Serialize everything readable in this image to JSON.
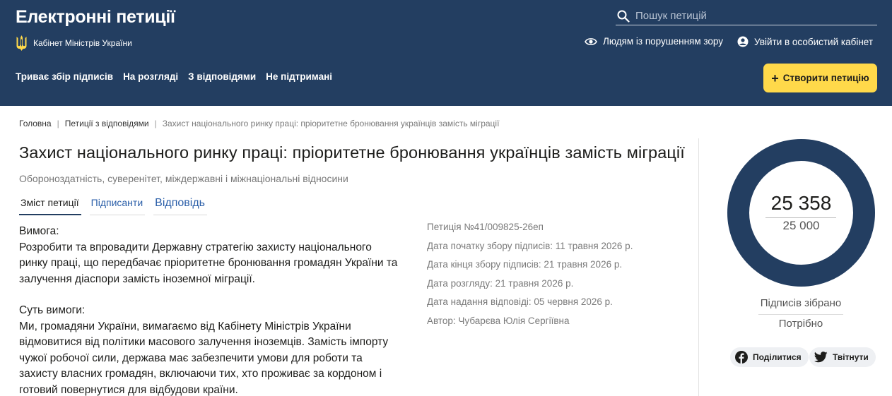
{
  "header": {
    "site_title": "Електронні петиції",
    "organization": "Кабінет Міністрів України",
    "search_placeholder": "Пошук петицій",
    "accessibility_label": "Людям із порушенням зору",
    "login_label": "Увійти в особистий кабінет",
    "nav": [
      {
        "label": "Триває збір підписів"
      },
      {
        "label": "На розгляді"
      },
      {
        "label": "З відповідями"
      },
      {
        "label": "Не підтримані"
      }
    ],
    "create_label": "Створити петицію",
    "accent_color": "#ffd94a",
    "brand_color": "#233e61"
  },
  "breadcrumb": {
    "home": "Головна",
    "section": "Петиції з відповідями",
    "current": "Захист національного ринку праці: пріоритетне бронювання українців замість міграції"
  },
  "petition": {
    "title": "Захист національного ринку праці: пріоритетне бронювання українців замість міграції",
    "category": "Обороноздатність, суверенітет, міждержавні і міжнаціональні відносини",
    "tabs": [
      {
        "label": "Зміст петиції"
      },
      {
        "label": "Підписанти"
      },
      {
        "label": "Відповідь"
      }
    ],
    "demand_heading": "Вимога:",
    "demand_text": "Розробити та впровадити Державну стратегію захисту національного ринку праці, що передбачає пріоритетне бронювання громадян України та залучення діаспори замість іноземної міграції.",
    "essence_heading": "Суть вимоги:",
    "essence_text": "Ми, громадяни України, вимагаємо від Кабінету Міністрів України відмовитися від політики масового залучення іноземців. Замість імпорту чужої робочої сили, держава має забезпечити умови для роботи та захисту власних громадян, включаючи тих, хто проживає за кордоном і готовий повернутися для відбудови країни."
  },
  "meta": {
    "number": "Петиція №41/009825-26еп",
    "start_date": "Дата початку збору підписів: 11 травня 2026 р.",
    "end_date": "Дата кінця збору підписів: 21 травня 2026 р.",
    "review_date": "Дата розгляду: 21 травня 2026 р.",
    "answer_date": "Дата надання відповіді: 05 червня 2026 р.",
    "author": "Автор: Чубарєва Юлія Сергіївна"
  },
  "counter": {
    "collected": "25 358",
    "needed": "25 000",
    "collected_label": "Підписів зібрано",
    "needed_label": "Потрібно",
    "progress_fraction": 1.0,
    "ring_color": "#233e61"
  },
  "share": {
    "facebook_label": "Поділитися",
    "twitter_label": "Твітнути"
  }
}
